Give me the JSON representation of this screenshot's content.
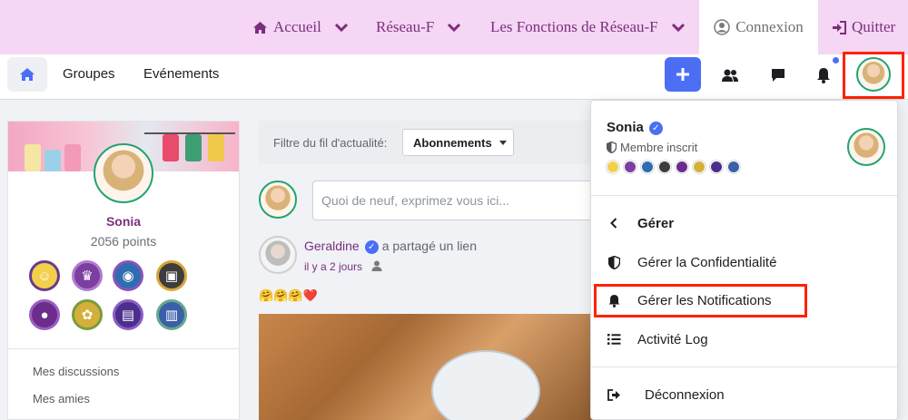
{
  "topnav": {
    "accueil": "Accueil",
    "reseau": "Réseau-F",
    "fonctions": "Les Fonctions de Réseau-F",
    "connexion": "Connexion",
    "quitter": "Quitter"
  },
  "nav2": {
    "groupes": "Groupes",
    "evenements": "Evénements"
  },
  "profile": {
    "name": "Sonia",
    "points": "2056 points",
    "links": [
      "Mes discussions",
      "Mes amies"
    ]
  },
  "feed": {
    "filter_label": "Filtre du fil d'actualité:",
    "filter_value": "Abonnements",
    "composer_placeholder": "Quoi de neuf, exprimez vous ici...",
    "post": {
      "author": "Geraldine",
      "action": "a partagé un lien",
      "time": "il y a 2 jours",
      "text": "🤗🤗🤗❤️"
    }
  },
  "menu": {
    "name": "Sonia",
    "role": "Membre inscrit",
    "items": {
      "manage": "Gérer",
      "privacy": "Gérer la Confidentialité",
      "notifications": "Gérer les Notifications",
      "activity": "Activité Log",
      "logout": "Déconnexion"
    }
  },
  "colors": {
    "brand_purple": "#7a2f7e",
    "top_bar": "#f5d6f4",
    "accent_blue": "#4c6ef5",
    "highlight_red": "#ff2200",
    "avatar_ring": "#20a474"
  }
}
